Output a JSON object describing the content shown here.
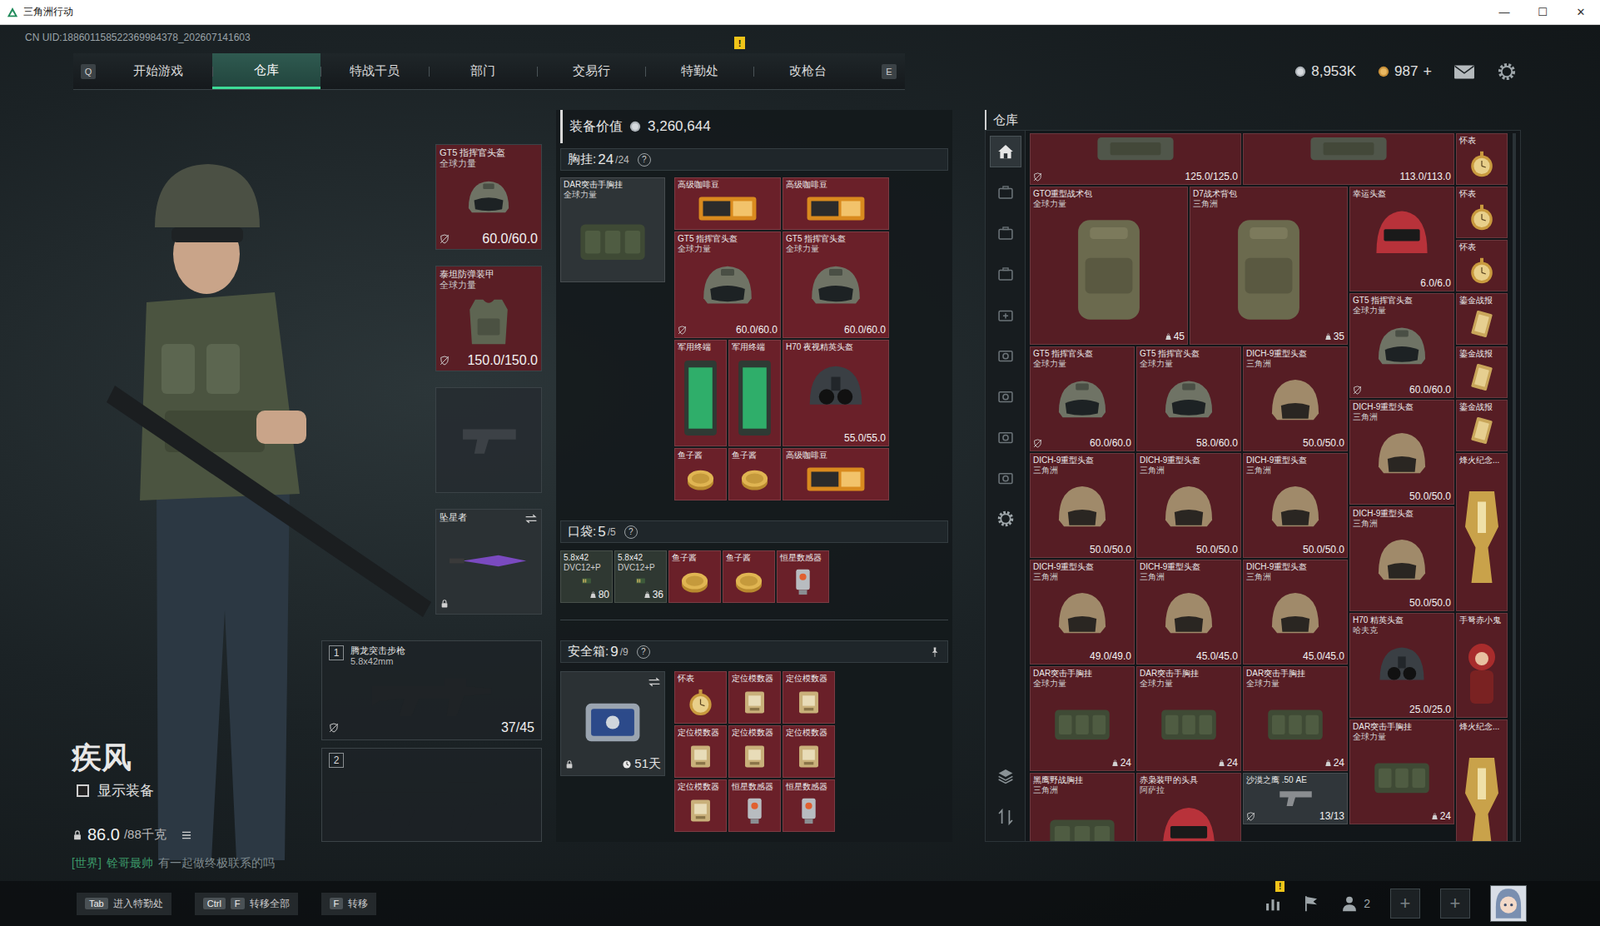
{
  "window": {
    "title": "三角洲行动",
    "controls": [
      "—",
      "☐",
      "✕"
    ]
  },
  "uid": "CN UID:188601158522369984378_202607141603",
  "nav": {
    "keys": [
      "Q",
      "E"
    ],
    "alert_mark": "!",
    "tabs": [
      {
        "label": "开始游戏",
        "selected": false,
        "alert": false
      },
      {
        "label": "仓库",
        "selected": true,
        "alert": false
      },
      {
        "label": "特战干员",
        "selected": false,
        "alert": false
      },
      {
        "label": "部门",
        "selected": false,
        "alert": false
      },
      {
        "label": "交易行",
        "selected": false,
        "alert": false
      },
      {
        "label": "特勤处",
        "selected": false,
        "alert": true
      },
      {
        "label": "改枪台",
        "selected": false,
        "alert": false
      }
    ]
  },
  "currency": [
    {
      "kind": "silver",
      "value": "8,953K"
    },
    {
      "kind": "gold",
      "value": "987",
      "action": "+"
    }
  ],
  "operator": {
    "name": "疾风",
    "show_gear": {
      "label": "显示装备",
      "checked": false
    },
    "weight": "86.0",
    "capacity": "/88千克",
    "chat": {
      "channel": "[世界]",
      "user": "铨哥最帅",
      "message": "有一起做终极联系的吗"
    }
  },
  "equipment": [
    {
      "kind": "helmet",
      "name": "GT5 指挥官头盔",
      "sub": "全球力量",
      "reading": "60.0/60.0",
      "color": "#5a1e25",
      "tag": true,
      "empty": false
    },
    {
      "kind": "armor",
      "name": "泰坦防弹装甲",
      "sub": "全球力量",
      "reading": "150.0/150.0",
      "color": "#5a1e25",
      "tag": true,
      "empty": false
    },
    {
      "kind": "pistol",
      "empty": true
    },
    {
      "kind": "knife",
      "name": "坠星者",
      "color": "#2b3134",
      "locked": true,
      "swap": true,
      "empty": false
    }
  ],
  "weapons": [
    {
      "index": "1",
      "kind": "rifle",
      "name": "腾龙突击步枪",
      "caliber": "5.8x42mm",
      "ammo": "37/45",
      "tag": true,
      "empty": false
    },
    {
      "index": "2",
      "kind": "rifle",
      "empty": true
    }
  ],
  "loadout": {
    "value_label": "装备价值",
    "value": "3,260,644",
    "chest": {
      "title": "胸挂: ",
      "count": "24",
      "capacity": "/24",
      "help": "?",
      "container": {
        "kind": "rig",
        "name": "DAR突击手胸挂",
        "sub": "全球力量",
        "color": "#2e3437"
      },
      "items": [
        {
          "kind": "coffee",
          "name": "高级咖啡豆",
          "color": "#6a2029"
        },
        {
          "kind": "coffee",
          "name": "高级咖啡豆",
          "color": "#6a2029"
        },
        {
          "kind": "helmet",
          "name": "GT5 指挥官头盔",
          "sub": "全球力量",
          "reading": "60.0/60.0",
          "tag": true,
          "color": "#6a2029"
        },
        {
          "kind": "helmet",
          "name": "GT5 指挥官头盔",
          "sub": "全球力量",
          "reading": "60.0/60.0",
          "tag": false,
          "color": "#6a2029"
        },
        {
          "kind": "terminal",
          "name": "军用终端",
          "color": "#6a2029"
        },
        {
          "kind": "terminal",
          "name": "军用终端",
          "color": "#6a2029"
        },
        {
          "kind": "nvg",
          "name": "H70 夜视精英头盔",
          "reading": "55.0/55.0",
          "color": "#6a2029"
        },
        {
          "kind": "caviar",
          "name": "鱼子酱",
          "color": "#6a2029"
        },
        {
          "kind": "caviar",
          "name": "鱼子酱",
          "color": "#6a2029"
        },
        {
          "kind": "coffee",
          "name": "高级咖啡豆",
          "color": "#6a2029"
        }
      ]
    },
    "pocket": {
      "title": "口袋: ",
      "count": "5",
      "capacity": "/5",
      "help": "?",
      "items": [
        {
          "kind": "ammo",
          "name": "5.8x42",
          "sub": "DVC12+P",
          "count": "80",
          "color": "#2f3832"
        },
        {
          "kind": "ammo",
          "name": "5.8x42",
          "sub": "DVC12+P",
          "count": "36",
          "color": "#2f3832"
        },
        {
          "kind": "caviar",
          "name": "鱼子酱",
          "color": "#6a2029"
        },
        {
          "kind": "caviar",
          "name": "鱼子酱",
          "color": "#6a2029"
        },
        {
          "kind": "sensor",
          "name": "恒星数感器",
          "color": "#6a2029"
        }
      ]
    },
    "safe": {
      "title": "安全箱: ",
      "count": "9",
      "capacity": "/9",
      "help": "?",
      "pinned": true,
      "box": {
        "days": "51天",
        "locked": true,
        "swap": true,
        "color": "#2b3134"
      },
      "items": [
        {
          "kind": "watch",
          "name": "怀表",
          "color": "#6a2029"
        },
        {
          "kind": "beacon",
          "name": "定位模数器",
          "color": "#6a2029"
        },
        {
          "kind": "beacon",
          "name": "定位模数器",
          "color": "#6a2029"
        },
        {
          "kind": "beacon",
          "name": "定位模数器",
          "color": "#6a2029"
        },
        {
          "kind": "beacon",
          "name": "定位模数器",
          "color": "#6a2029"
        },
        {
          "kind": "beacon",
          "name": "定位模数器",
          "color": "#6a2029"
        },
        {
          "kind": "beacon",
          "name": "定位模数器",
          "color": "#6a2029"
        },
        {
          "kind": "sensor",
          "name": "恒星数感器",
          "color": "#6a2029"
        },
        {
          "kind": "sensor",
          "name": "恒星数感器",
          "color": "#6a2029"
        }
      ]
    }
  },
  "store": {
    "title": "仓库",
    "tabs": [
      {
        "kind": "home",
        "selected": true
      },
      {
        "kind": "case",
        "selected": false
      },
      {
        "kind": "case",
        "selected": false
      },
      {
        "kind": "case",
        "selected": false
      },
      {
        "kind": "case-plus",
        "selected": false
      },
      {
        "kind": "lens",
        "selected": false
      },
      {
        "kind": "lens",
        "selected": false
      },
      {
        "kind": "lens",
        "selected": false
      },
      {
        "kind": "lens",
        "selected": false
      },
      {
        "kind": "gear",
        "selected": false
      }
    ],
    "tools": [
      {
        "kind": "layers"
      },
      {
        "kind": "sort"
      }
    ],
    "items": [
      {
        "kind": "armor-end",
        "reading": "125.0/125.0",
        "tag": true,
        "at": [
          1,
          1
        ],
        "color": "#561d24"
      },
      {
        "kind": "armor-end",
        "reading": "113.0/113.0",
        "at": [
          5,
          1
        ],
        "color": "#561d24"
      },
      {
        "kind": "watch",
        "name": "怀表",
        "at": [
          9,
          1
        ],
        "color": "#561d24"
      },
      {
        "kind": "backpack",
        "name": "GTO重型战术包",
        "sub": "全球力量",
        "count": "45",
        "at": [
          1,
          2
        ],
        "color": "#561d24"
      },
      {
        "kind": "backpack",
        "name": "D7战术背包",
        "sub": "三角洲",
        "count": "35",
        "at": [
          4,
          2
        ],
        "color": "#561d24"
      },
      {
        "kind": "lucky",
        "name": "幸运头盔",
        "reading": "6.0/6.0",
        "at": [
          7,
          2
        ],
        "color": "#561d24"
      },
      {
        "kind": "watch",
        "name": "怀表",
        "at": [
          9,
          2
        ],
        "color": "#561d24"
      },
      {
        "kind": "watch",
        "name": "怀表",
        "at": [
          9,
          3
        ],
        "color": "#561d24"
      },
      {
        "kind": "helmet",
        "name": "GT5 指挥官头盔",
        "sub": "全球力量",
        "reading": "60.0/60.0",
        "tag": true,
        "at": [
          7,
          4
        ],
        "color": "#561d24"
      },
      {
        "kind": "card",
        "name": "鎏金战报",
        "at": [
          9,
          4
        ],
        "color": "#561d24"
      },
      {
        "kind": "card",
        "name": "鎏金战报",
        "at": [
          9,
          5
        ],
        "color": "#561d24"
      },
      {
        "kind": "card",
        "name": "鎏金战报",
        "at": [
          9,
          6
        ],
        "color": "#561d24"
      },
      {
        "kind": "helmet",
        "name": "GT5 指挥官头盔",
        "sub": "全球力量",
        "reading": "60.0/60.0",
        "tag": true,
        "at": [
          1,
          5
        ],
        "color": "#561d24"
      },
      {
        "kind": "helmet",
        "name": "GT5 指挥官头盔",
        "sub": "全球力量",
        "reading": "58.0/60.0",
        "at": [
          3,
          5
        ],
        "color": "#561d24"
      },
      {
        "kind": "dich",
        "name": "DICH-9重型头盔",
        "sub": "三角洲",
        "reading": "50.0/50.0",
        "at": [
          5,
          5
        ],
        "color": "#561d24"
      },
      {
        "kind": "dich",
        "name": "DICH-9重型头盔",
        "sub": "三角洲",
        "reading": "50.0/50.0",
        "at": [
          7,
          6
        ],
        "color": "#561d24"
      },
      {
        "kind": "dich",
        "name": "DICH-9重型头盔",
        "sub": "三角洲",
        "reading": "50.0/50.0",
        "at": [
          1,
          7
        ],
        "color": "#561d24"
      },
      {
        "kind": "dich",
        "name": "DICH-9重型头盔",
        "sub": "三角洲",
        "reading": "50.0/50.0",
        "at": [
          3,
          7
        ],
        "color": "#561d24"
      },
      {
        "kind": "dich",
        "name": "DICH-9重型头盔",
        "sub": "三角洲",
        "reading": "50.0/50.0",
        "at": [
          5,
          7
        ],
        "color": "#561d24"
      },
      {
        "kind": "trophy",
        "name": "烽火纪念...",
        "at": [
          9,
          7
        ],
        "color": "#561d24"
      },
      {
        "kind": "dich",
        "name": "DICH-9重型头盔",
        "sub": "三角洲",
        "reading": "50.0/50.0",
        "at": [
          7,
          8
        ],
        "color": "#561d24"
      },
      {
        "kind": "dich",
        "name": "DICH-9重型头盔",
        "sub": "三角洲",
        "reading": "49.0/49.0",
        "at": [
          1,
          9
        ],
        "color": "#561d24"
      },
      {
        "kind": "dich",
        "name": "DICH-9重型头盔",
        "sub": "三角洲",
        "reading": "45.0/45.0",
        "at": [
          3,
          9
        ],
        "color": "#561d24"
      },
      {
        "kind": "dich",
        "name": "DICH-9重型头盔",
        "sub": "三角洲",
        "reading": "45.0/45.0",
        "at": [
          5,
          9
        ],
        "color": "#561d24"
      },
      {
        "kind": "nvg",
        "name": "H70 精英头盔",
        "sub": "哈夫克",
        "reading": "25.0/25.0",
        "at": [
          7,
          10
        ],
        "color": "#561d24"
      },
      {
        "kind": "figure",
        "name": "手弩赤小鬼",
        "at": [
          9,
          10
        ],
        "color": "#561d24"
      },
      {
        "kind": "rig",
        "name": "DAR突击手胸挂",
        "sub": "全球力量",
        "count": "24",
        "at": [
          1,
          11
        ],
        "color": "#561d24"
      },
      {
        "kind": "rig",
        "name": "DAR突击手胸挂",
        "sub": "全球力量",
        "count": "24",
        "at": [
          3,
          11
        ],
        "color": "#561d24"
      },
      {
        "kind": "rig",
        "name": "DAR突击手胸挂",
        "sub": "全球力量",
        "count": "24",
        "at": [
          5,
          11
        ],
        "color": "#561d24"
      },
      {
        "kind": "rig",
        "name": "DAR突击手胸挂",
        "sub": "全球力量",
        "count": "24",
        "at": [
          7,
          12
        ],
        "color": "#561d24"
      },
      {
        "kind": "trophy",
        "name": "烽火纪念...",
        "at": [
          9,
          12
        ],
        "color": "#561d24"
      },
      {
        "kind": "rig",
        "name": "黑鹰野战胸挂",
        "sub": "三角洲",
        "at": [
          1,
          13
        ],
        "color": "#561d24"
      },
      {
        "kind": "lucky",
        "name": "赤枭装甲的头具",
        "sub": "阿萨拉",
        "at": [
          3,
          13
        ],
        "color": "#561d24"
      },
      {
        "kind": "pistol",
        "name": "沙漠之鹰 .50 AE",
        "reading": "13/13",
        "tag": true,
        "at": [
          5,
          13
        ],
        "color": "#30363a"
      }
    ]
  },
  "bottom": {
    "hints": [
      {
        "keys": [
          "Tab"
        ],
        "label": "进入特勤处"
      },
      {
        "keys": [
          "Ctrl",
          "F"
        ],
        "label": "转移全部"
      },
      {
        "keys": [
          "F"
        ],
        "label": "转移"
      }
    ],
    "stats_alert": "!",
    "squad": "2",
    "slots": [
      "+",
      "+"
    ]
  }
}
